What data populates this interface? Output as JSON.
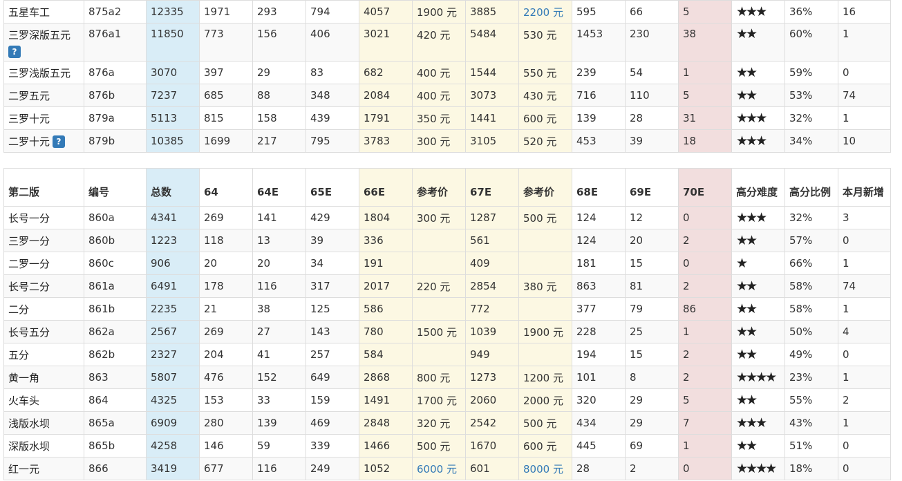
{
  "table1": {
    "rows": [
      {
        "name": "五星车工",
        "help": false,
        "code": "875a2",
        "total": "12335",
        "c64": "1971",
        "c64e": "293",
        "c65e": "794",
        "c66e": "4057",
        "p1": "1900 元",
        "p1_link": false,
        "c67e": "3885",
        "p2": "2200 元",
        "p2_link": true,
        "c68e": "595",
        "c69e": "66",
        "c70e": "5",
        "stars": "★★★",
        "ratio": "36%",
        "new": "16"
      },
      {
        "name": "三罗深版五元",
        "help": true,
        "code": "876a1",
        "total": "11850",
        "c64": "773",
        "c64e": "156",
        "c65e": "406",
        "c66e": "3021",
        "p1": "420 元",
        "p1_link": false,
        "c67e": "5484",
        "p2": "530 元",
        "p2_link": false,
        "c68e": "1453",
        "c69e": "230",
        "c70e": "38",
        "stars": "★★",
        "ratio": "60%",
        "new": "1"
      },
      {
        "name": "三罗浅版五元",
        "help": false,
        "code": "876a",
        "total": "3070",
        "c64": "397",
        "c64e": "29",
        "c65e": "83",
        "c66e": "682",
        "p1": "400 元",
        "p1_link": false,
        "c67e": "1544",
        "p2": "550 元",
        "p2_link": false,
        "c68e": "239",
        "c69e": "54",
        "c70e": "1",
        "stars": "★★",
        "ratio": "59%",
        "new": "0"
      },
      {
        "name": "二罗五元",
        "help": false,
        "code": "876b",
        "total": "7237",
        "c64": "685",
        "c64e": "88",
        "c65e": "348",
        "c66e": "2084",
        "p1": "400 元",
        "p1_link": false,
        "c67e": "3073",
        "p2": "430 元",
        "p2_link": false,
        "c68e": "716",
        "c69e": "110",
        "c70e": "5",
        "stars": "★★",
        "ratio": "53%",
        "new": "74"
      },
      {
        "name": "三罗十元",
        "help": false,
        "code": "879a",
        "total": "5113",
        "c64": "815",
        "c64e": "158",
        "c65e": "439",
        "c66e": "1791",
        "p1": "350 元",
        "p1_link": false,
        "c67e": "1441",
        "p2": "600 元",
        "p2_link": false,
        "c68e": "139",
        "c69e": "28",
        "c70e": "31",
        "stars": "★★★",
        "ratio": "32%",
        "new": "1"
      },
      {
        "name": "二罗十元",
        "help": true,
        "code": "879b",
        "total": "10385",
        "c64": "1699",
        "c64e": "217",
        "c65e": "795",
        "c66e": "3783",
        "p1": "300 元",
        "p1_link": false,
        "c67e": "3105",
        "p2": "520 元",
        "p2_link": false,
        "c68e": "453",
        "c69e": "39",
        "c70e": "18",
        "stars": "★★★",
        "ratio": "34%",
        "new": "10"
      }
    ]
  },
  "table2": {
    "headers": {
      "edition": "第二版",
      "code": "编号",
      "total": "总数",
      "c64": "64",
      "c64e": "64E",
      "c65e": "65E",
      "c66e": "66E",
      "p1": "参考价",
      "c67e": "67E",
      "p2": "参考价",
      "c68e": "68E",
      "c69e": "69E",
      "c70e": "70E",
      "difficulty": "高分难度",
      "ratio": "高分比例",
      "new": "本月新增"
    },
    "rows": [
      {
        "name": "长号一分",
        "code": "860a",
        "total": "4341",
        "c64": "269",
        "c64e": "141",
        "c65e": "429",
        "c66e": "1804",
        "p1": "300 元",
        "p1_link": false,
        "c67e": "1287",
        "p2": "500 元",
        "p2_link": false,
        "c68e": "124",
        "c69e": "12",
        "c70e": "0",
        "stars": "★★★",
        "ratio": "32%",
        "new": "3"
      },
      {
        "name": "三罗一分",
        "code": "860b",
        "total": "1223",
        "c64": "118",
        "c64e": "13",
        "c65e": "39",
        "c66e": "336",
        "p1": "",
        "p1_link": false,
        "c67e": "561",
        "p2": "",
        "p2_link": false,
        "c68e": "124",
        "c69e": "20",
        "c70e": "2",
        "stars": "★★",
        "ratio": "57%",
        "new": "0"
      },
      {
        "name": "二罗一分",
        "code": "860c",
        "total": "906",
        "c64": "20",
        "c64e": "20",
        "c65e": "34",
        "c66e": "191",
        "p1": "",
        "p1_link": false,
        "c67e": "409",
        "p2": "",
        "p2_link": false,
        "c68e": "181",
        "c69e": "15",
        "c70e": "0",
        "stars": "★",
        "ratio": "66%",
        "new": "1"
      },
      {
        "name": "长号二分",
        "code": "861a",
        "total": "6491",
        "c64": "178",
        "c64e": "116",
        "c65e": "317",
        "c66e": "2017",
        "p1": "220 元",
        "p1_link": false,
        "c67e": "2854",
        "p2": "380 元",
        "p2_link": false,
        "c68e": "863",
        "c69e": "81",
        "c70e": "2",
        "stars": "★★",
        "ratio": "58%",
        "new": "74"
      },
      {
        "name": "二分",
        "code": "861b",
        "total": "2235",
        "c64": "21",
        "c64e": "38",
        "c65e": "125",
        "c66e": "586",
        "p1": "",
        "p1_link": false,
        "c67e": "772",
        "p2": "",
        "p2_link": false,
        "c68e": "377",
        "c69e": "79",
        "c70e": "86",
        "stars": "★★",
        "ratio": "58%",
        "new": "1"
      },
      {
        "name": "长号五分",
        "code": "862a",
        "total": "2567",
        "c64": "269",
        "c64e": "27",
        "c65e": "143",
        "c66e": "780",
        "p1": "1500 元",
        "p1_link": false,
        "c67e": "1039",
        "p2": "1900 元",
        "p2_link": false,
        "c68e": "228",
        "c69e": "25",
        "c70e": "1",
        "stars": "★★",
        "ratio": "50%",
        "new": "4"
      },
      {
        "name": "五分",
        "code": "862b",
        "total": "2327",
        "c64": "204",
        "c64e": "41",
        "c65e": "257",
        "c66e": "584",
        "p1": "",
        "p1_link": false,
        "c67e": "949",
        "p2": "",
        "p2_link": false,
        "c68e": "194",
        "c69e": "15",
        "c70e": "2",
        "stars": "★★",
        "ratio": "49%",
        "new": "0"
      },
      {
        "name": "黄一角",
        "code": "863",
        "total": "5807",
        "c64": "476",
        "c64e": "152",
        "c65e": "649",
        "c66e": "2868",
        "p1": "800 元",
        "p1_link": false,
        "c67e": "1273",
        "p2": "1200 元",
        "p2_link": false,
        "c68e": "101",
        "c69e": "8",
        "c70e": "2",
        "stars": "★★★★",
        "ratio": "23%",
        "new": "1"
      },
      {
        "name": "火车头",
        "code": "864",
        "total": "4325",
        "c64": "153",
        "c64e": "33",
        "c65e": "159",
        "c66e": "1491",
        "p1": "1700 元",
        "p1_link": false,
        "c67e": "2060",
        "p2": "2000 元",
        "p2_link": false,
        "c68e": "320",
        "c69e": "29",
        "c70e": "5",
        "stars": "★★",
        "ratio": "55%",
        "new": "2"
      },
      {
        "name": "浅版水坝",
        "code": "865a",
        "total": "6909",
        "c64": "280",
        "c64e": "139",
        "c65e": "469",
        "c66e": "2848",
        "p1": "320 元",
        "p1_link": false,
        "c67e": "2542",
        "p2": "500 元",
        "p2_link": false,
        "c68e": "434",
        "c69e": "29",
        "c70e": "7",
        "stars": "★★★",
        "ratio": "43%",
        "new": "1"
      },
      {
        "name": "深版水坝",
        "code": "865b",
        "total": "4258",
        "c64": "146",
        "c64e": "59",
        "c65e": "339",
        "c66e": "1466",
        "p1": "500 元",
        "p1_link": false,
        "c67e": "1670",
        "p2": "600 元",
        "p2_link": false,
        "c68e": "445",
        "c69e": "69",
        "c70e": "1",
        "stars": "★★",
        "ratio": "51%",
        "new": "0"
      },
      {
        "name": "红一元",
        "code": "866",
        "total": "3419",
        "c64": "677",
        "c64e": "116",
        "c65e": "249",
        "c66e": "1052",
        "p1": "6000 元",
        "p1_link": true,
        "c67e": "601",
        "p2": "8000 元",
        "p2_link": true,
        "c68e": "28",
        "c69e": "2",
        "c70e": "0",
        "stars": "★★★★",
        "ratio": "18%",
        "new": "0"
      }
    ]
  }
}
